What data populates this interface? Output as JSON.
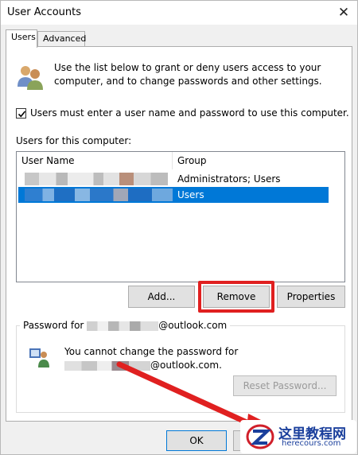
{
  "window": {
    "title": "User Accounts"
  },
  "tabs": [
    {
      "label": "Users",
      "active": true
    },
    {
      "label": "Advanced",
      "active": false
    }
  ],
  "intro_text": "Use the list below to grant or deny users access to your computer, and to change passwords and other settings.",
  "require_login": {
    "checked": true,
    "label": "Users must enter a user name and password to use this computer."
  },
  "users_list": {
    "label": "Users for this computer:",
    "columns": [
      "User Name",
      "Group"
    ],
    "rows": [
      {
        "user_name": "",
        "group": "Administrators; Users",
        "selected": false
      },
      {
        "user_name": "",
        "group": "Users",
        "selected": true
      }
    ]
  },
  "list_buttons": {
    "add": "Add...",
    "remove": "Remove",
    "properties": "Properties"
  },
  "password": {
    "legend": "Password for                 @outlook.com",
    "legend_suffix": "@outlook.com",
    "message_line1": "You cannot change the password for",
    "message_line2_suffix": "@outlook.com.",
    "reset_button": "Reset Password..."
  },
  "footer": {
    "ok": "OK"
  },
  "watermark": {
    "title": "这里教程网",
    "subtitle": "herecours.com"
  },
  "colors": {
    "selection": "#0078d7",
    "highlight": "#e02020",
    "logo": "#1a3f9c"
  }
}
